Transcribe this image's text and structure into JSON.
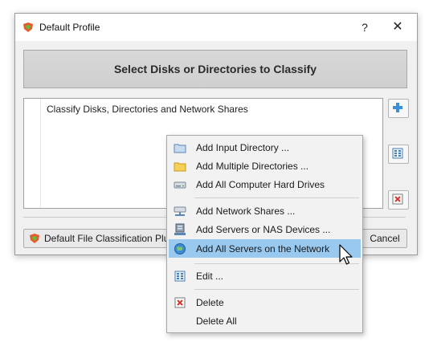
{
  "window": {
    "title": "Default Profile",
    "help_glyph": "?",
    "close_glyph": "✕",
    "icon": "profile-icon"
  },
  "header": {
    "title": "Select Disks or Directories to Classify"
  },
  "list": {
    "items": [
      "Classify Disks, Directories and Network Shares"
    ]
  },
  "side_buttons": {
    "add_icon": "plus-icon",
    "edit_icon": "edit-icon",
    "delete_icon": "delete-icon"
  },
  "footer": {
    "plugin_label": "Default File Classification Plugin",
    "cancel_label": "Cancel"
  },
  "context_menu": {
    "items": [
      {
        "label": "Add Input Directory ...",
        "icon": "folder-blue-icon"
      },
      {
        "label": "Add Multiple Directories ...",
        "icon": "folder-yellow-icon"
      },
      {
        "label": "Add All Computer Hard Drives",
        "icon": "hard-drive-icon"
      },
      {
        "label": "Add Network Shares ...",
        "icon": "network-share-icon"
      },
      {
        "label": "Add Servers or NAS Devices ...",
        "icon": "server-icon"
      },
      {
        "label": "Add All Servers on the Network",
        "icon": "globe-icon",
        "highlighted": true
      },
      {
        "label": "Edit ...",
        "icon": "edit-icon"
      },
      {
        "label": "Delete",
        "icon": "delete-icon"
      },
      {
        "label": "Delete All",
        "icon": ""
      }
    ]
  },
  "colors": {
    "menu_highlight": "#99c9ef",
    "dialog_bg": "#f0f0f0"
  }
}
